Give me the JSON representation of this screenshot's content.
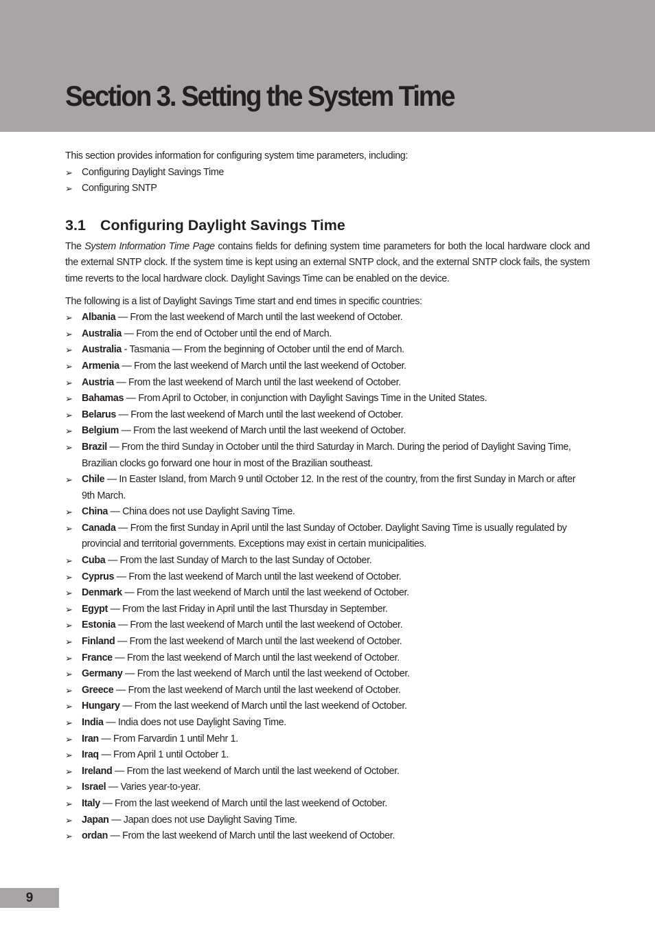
{
  "header": {
    "section_title": "Section 3.  Setting the System Time"
  },
  "intro": {
    "text": "This section provides information for configuring system time parameters, including:",
    "bullets": [
      "Configuring Daylight Savings Time",
      "Configuring SNTP"
    ]
  },
  "subsection": {
    "number": "3.1",
    "title": "Configuring Daylight Savings Time",
    "para_prefix": "The ",
    "para_italic": "System Information Time Page",
    "para_rest": " contains fields for defining system time parameters for both the local hardware clock and the external SNTP clock. If the system time is kept using an external SNTP clock, and the external SNTP clock fails, the system time reverts to the local hardware clock. Daylight Savings Time can be enabled on the device.",
    "list_intro": "The following is a list of Daylight Savings Time start and end times in specific countries:"
  },
  "countries": [
    {
      "name": "Albania",
      "desc": " — From the last weekend of March until the last weekend of October."
    },
    {
      "name": "Australia",
      "desc": " — From the end of October until the end of March."
    },
    {
      "name": "Australia",
      "desc": " - Tasmania — From the beginning of October until the end of March."
    },
    {
      "name": "Armenia",
      "desc": " — From the last weekend of March until the last weekend of October."
    },
    {
      "name": "Austria",
      "desc": " — From the last weekend of March until the last weekend of October."
    },
    {
      "name": "Bahamas",
      "desc": " — From April to October, in conjunction with Daylight Savings Time in the United States."
    },
    {
      "name": "Belarus",
      "desc": " — From the last weekend of March until the last weekend of October."
    },
    {
      "name": "Belgium",
      "desc": " — From the last weekend of March until the last weekend of October."
    },
    {
      "name": "Brazil",
      "desc": " — From the third Sunday in October until the third Saturday in March. During the period of Daylight Saving Time, Brazilian clocks go forward one hour in most of the Brazilian southeast."
    },
    {
      "name": "Chile",
      "desc": " — In Easter Island, from March 9 until October 12. In the rest of the country, from the first Sunday in March or after 9th March."
    },
    {
      "name": "China",
      "desc": " — China does not use Daylight Saving Time."
    },
    {
      "name": "Canada",
      "desc": " — From the first Sunday in April until the last Sunday of October. Daylight Saving Time is usually regulated by provincial and territorial governments. Exceptions may exist in certain municipalities."
    },
    {
      "name": "Cuba",
      "desc": " — From the last Sunday of March to the last Sunday of October."
    },
    {
      "name": "Cyprus",
      "desc": " — From the last weekend of March until the last weekend of October."
    },
    {
      "name": "Denmark",
      "desc": " — From the last weekend of March until the last weekend of October."
    },
    {
      "name": "Egypt",
      "desc": " — From the last Friday in April until the last Thursday in September."
    },
    {
      "name": "Estonia",
      "desc": " — From the last weekend of March until the last weekend of October."
    },
    {
      "name": "Finland",
      "desc": " — From the last weekend of March until the last weekend of October."
    },
    {
      "name": "France",
      "desc": " — From the last weekend of March until the last weekend of October."
    },
    {
      "name": "Germany",
      "desc": " — From the last weekend of March until the last weekend of October."
    },
    {
      "name": "Greece",
      "desc": " — From the last weekend of March until the last weekend of October."
    },
    {
      "name": "Hungary",
      "desc": " — From the last weekend of March until the last weekend of October."
    },
    {
      "name": "India",
      "desc": " — India does not use Daylight Saving Time."
    },
    {
      "name": "Iran",
      "desc": " — From Farvardin 1 until Mehr 1."
    },
    {
      "name": "Iraq",
      "desc": " — From April 1 until October 1."
    },
    {
      "name": "Ireland",
      "desc": " — From the last weekend of March until the last weekend of October."
    },
    {
      "name": "Israel",
      "desc": " — Varies year-to-year."
    },
    {
      "name": "Italy",
      "desc": " — From the last weekend of March until the last weekend of October."
    },
    {
      "name": "Japan",
      "desc": " — Japan does not use Daylight Saving Time."
    },
    {
      "name": "ordan",
      "desc": " — From the last weekend of March until the last weekend of October."
    }
  ],
  "icons": {
    "bullet": "➢"
  },
  "footer": {
    "page_number": "9"
  }
}
